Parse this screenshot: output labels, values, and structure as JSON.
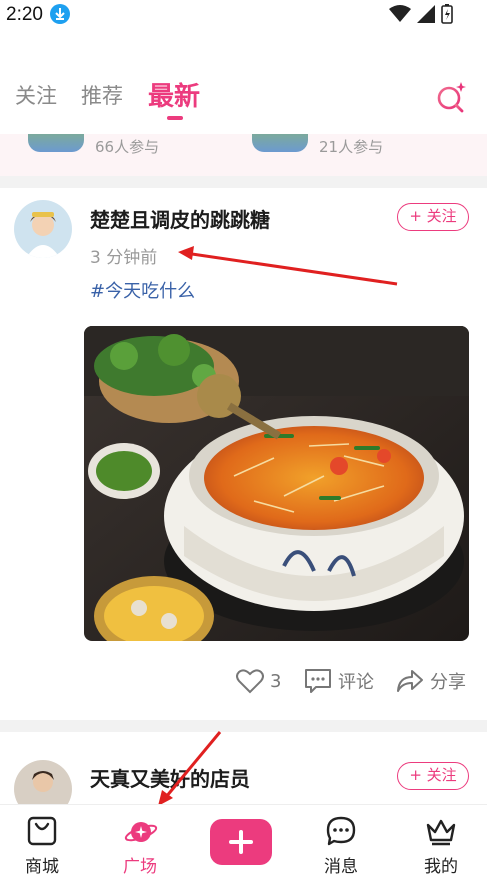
{
  "status_bar": {
    "time": "2:20"
  },
  "top_tabs": [
    {
      "label": "关注",
      "active": false
    },
    {
      "label": "推荐",
      "active": false
    },
    {
      "label": "最新",
      "active": true
    }
  ],
  "topic_strip": [
    {
      "count": "66人参与"
    },
    {
      "count": "21人参与"
    }
  ],
  "posts": [
    {
      "author": "楚楚且调皮的跳跳糖",
      "follow_label": "+ 关注",
      "time": "3 分钟前",
      "tag": "#今天吃什么",
      "likes": "3",
      "comment_label": "评论",
      "share_label": "分享"
    },
    {
      "author": "天真又美好的店员",
      "follow_label": "+ 关注"
    }
  ],
  "bottom_nav": [
    {
      "label": "商城",
      "icon": "bag-icon",
      "active": false
    },
    {
      "label": "广场",
      "icon": "planet-icon",
      "active": true
    },
    {
      "label": "",
      "icon": "plus-icon",
      "active": false
    },
    {
      "label": "消息",
      "icon": "chat-icon",
      "active": false
    },
    {
      "label": "我的",
      "icon": "crown-icon",
      "active": false
    }
  ],
  "colors": {
    "accent": "#ec3b7e",
    "tag_blue": "#3a62a8",
    "annotation_red": "#e02020"
  }
}
